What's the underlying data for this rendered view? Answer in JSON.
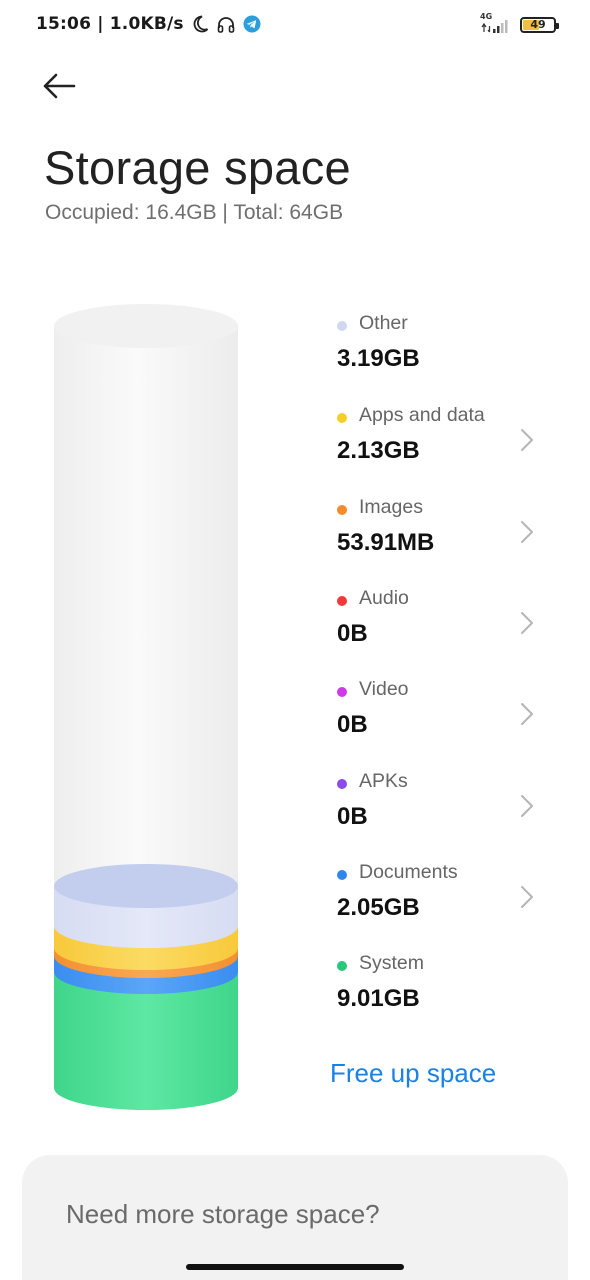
{
  "status_bar": {
    "time_speed": "15:06 | 1.0KB/s",
    "network_type": "4G",
    "battery_level": "49",
    "battery_fraction": 0.49,
    "icons": [
      "moon-icon",
      "headphones-icon",
      "telegram-icon",
      "signal-icon",
      "battery-icon"
    ]
  },
  "header": {
    "back_icon": "arrow-left-icon",
    "title": "Storage space",
    "subtitle": "Occupied: 16.4GB | Total: 64GB"
  },
  "legend": [
    {
      "label": "Other",
      "value": "3.19GB",
      "color": "#cfd8ee",
      "chevron": false
    },
    {
      "label": "Apps and data",
      "value": "2.13GB",
      "color": "#f5ce2a",
      "chevron": true
    },
    {
      "label": "Images",
      "value": "53.91MB",
      "color": "#f48b2c",
      "chevron": true
    },
    {
      "label": "Audio",
      "value": "0B",
      "color": "#ef3a3a",
      "chevron": true
    },
    {
      "label": "Video",
      "value": "0B",
      "color": "#cf3ae8",
      "chevron": true
    },
    {
      "label": "APKs",
      "value": "0B",
      "color": "#8a4be8",
      "chevron": true
    },
    {
      "label": "Documents",
      "value": "2.05GB",
      "color": "#2f86ee",
      "chevron": true
    },
    {
      "label": "System",
      "value": "9.01GB",
      "color": "#27c77e",
      "chevron": false
    }
  ],
  "actions": {
    "free_up_label": "Free up space"
  },
  "bottom_card": {
    "text": "Need more storage space?"
  },
  "colors": {
    "accent": "#1a82e4",
    "system": "#3fdc8c",
    "documents": "#3d8ff2",
    "images": "#f59a3f",
    "apps": "#f9cd45",
    "other": "#d9def2"
  }
}
